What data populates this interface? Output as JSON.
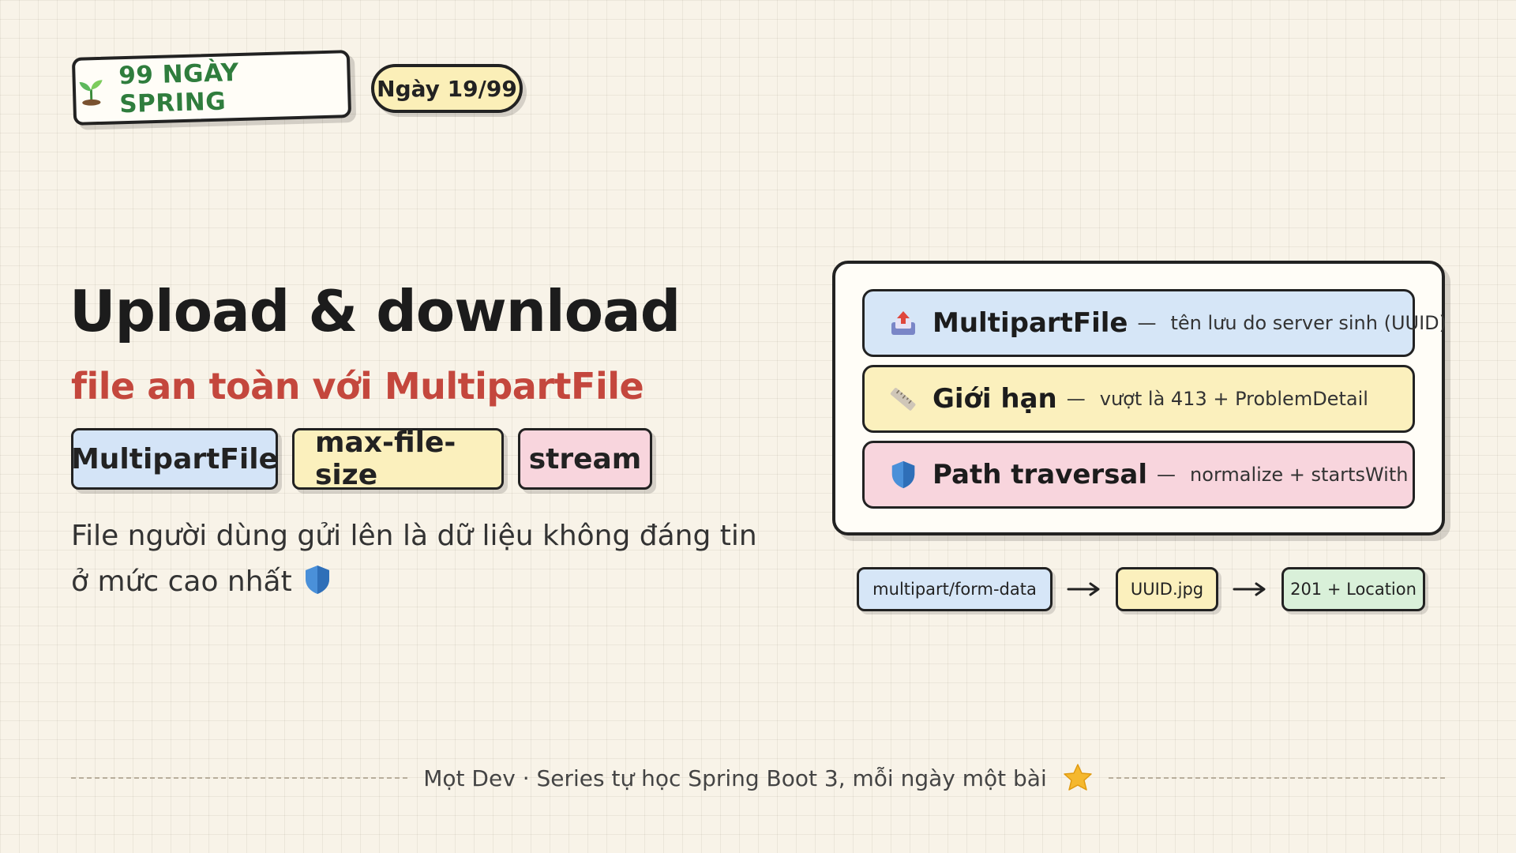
{
  "header": {
    "series_label": "99 NGÀY SPRING",
    "day_label": "Ngày 19/99"
  },
  "main": {
    "title": "Upload & download",
    "subtitle": "file an toàn với MultipartFile",
    "tags": [
      "MultipartFile",
      "max-file-size",
      "stream"
    ],
    "description": "File người dùng gửi lên là dữ liệu không đáng tin ở mức cao nhất"
  },
  "card": {
    "rows": [
      {
        "name": "MultipartFile",
        "separator": "—",
        "note": "tên lưu do server sinh (UUID)",
        "icon": "upload-tray-icon"
      },
      {
        "name": "Giới hạn",
        "separator": "—",
        "note": "vượt là 413 + ProblemDetail",
        "icon": "ruler-icon"
      },
      {
        "name": "Path traversal",
        "separator": "—",
        "note": "normalize + startsWith",
        "icon": "shield-icon"
      }
    ]
  },
  "flow": {
    "steps": [
      "multipart/form-data",
      "UUID.jpg",
      "201 + Location"
    ]
  },
  "footer": {
    "text": "Mọt Dev · Series tự học Spring Boot 3, mỗi ngày một bài"
  },
  "colors": {
    "accent_green": "#2f7d3d",
    "accent_red": "#c4473d",
    "blue_fill": "#d6e6f7",
    "yellow_fill": "#fbf0bd",
    "pink_fill": "#f8d5dd",
    "green_fill": "#d9f0d9"
  }
}
